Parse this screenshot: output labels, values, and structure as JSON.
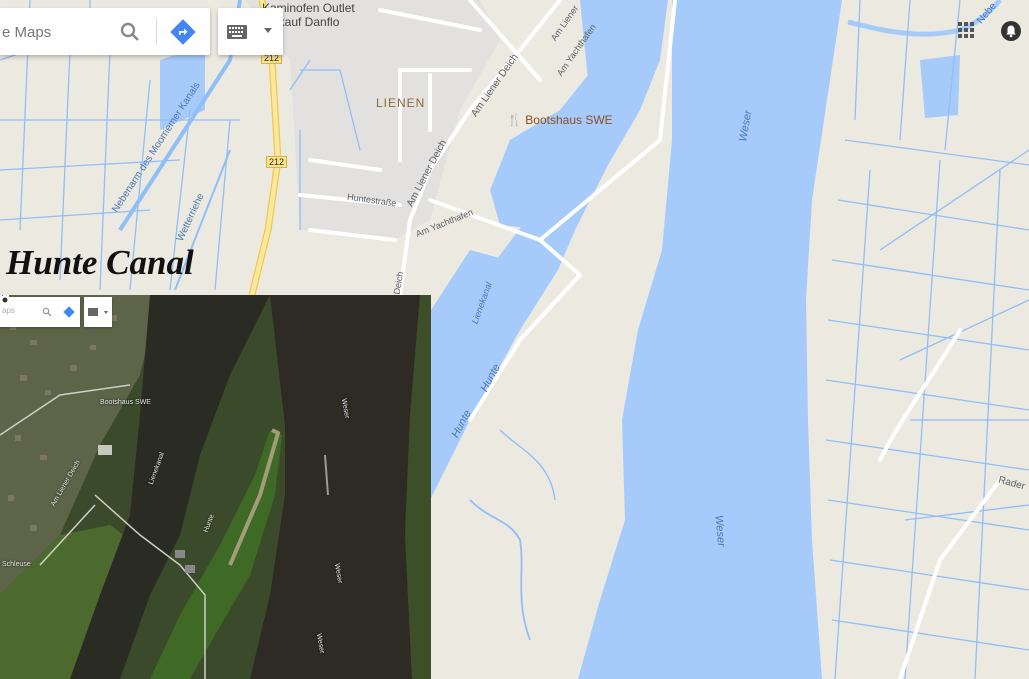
{
  "map": {
    "search": {
      "placeholder": "e Maps"
    },
    "labels": {
      "kaminofen_1": "Kaminofen Outlet",
      "kaminofen_2": "verkauf Danflo",
      "lienen": "LIENEN",
      "bootshaus": "Bootshaus SWE",
      "am_liener_deich_1": "Am Liener Deich",
      "am_liener_deich_2": "Am Liener Deich",
      "am_liener_deich_3": "Am Liener",
      "am_yachthafen_1": "Am Yachthafen",
      "am_yachthafen_2": "Am Yachthafen",
      "huntestrasse": "Huntestraße",
      "deich": "Deich",
      "nebenarm": "Nebenarm des Moorriemer Kanals",
      "wetterriehe": "Wetterriehe",
      "lienekanal": "Lienekanal",
      "hunte_1": "Hunte",
      "hunte_2": "Hunte",
      "weser_1": "Weser",
      "weser_2": "Weser",
      "rader": "Rader",
      "road_212_a": "212",
      "road_212_b": "212",
      "neben_tr": "Nebe"
    },
    "title": "Hunte Canal",
    "inset": {
      "search_placeholder": "aps",
      "labels": {
        "bootshaus": "Bootshaus SWE",
        "weser_1": "Weser",
        "weser_2": "Weser",
        "weser_3": "Weser",
        "hunte": "Hunte",
        "schleuse": "Schleuse",
        "deich": "Am Liener Deich",
        "kanal": "Lienekanal"
      }
    },
    "icons": [
      "search-icon",
      "directions-icon",
      "keyboard-icon",
      "apps-icon",
      "notifications-icon"
    ],
    "colors": {
      "water": "#a6cbfb",
      "land": "#ece9e1",
      "road_major": "#f8e08e",
      "road_minor": "#ffffff",
      "canal": "#8fbff8"
    }
  }
}
